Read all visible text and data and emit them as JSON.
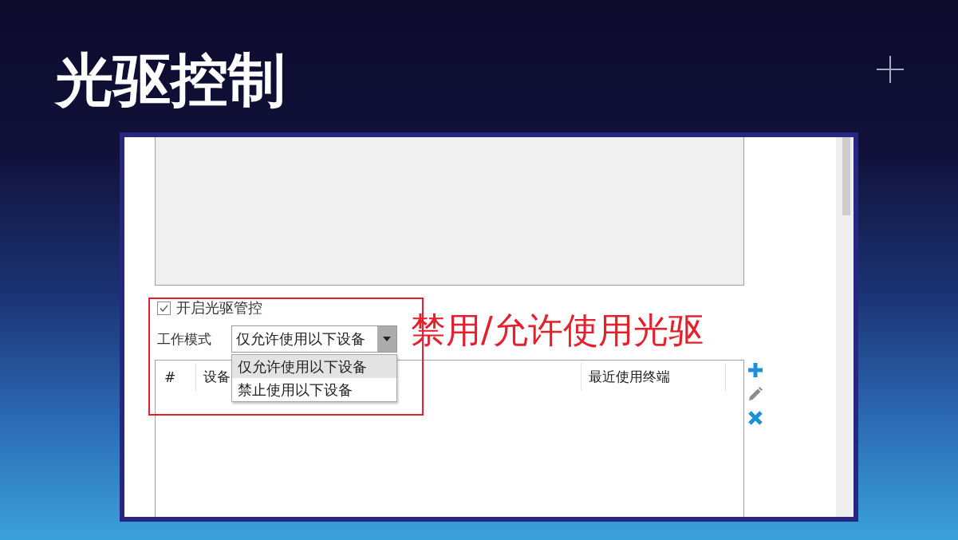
{
  "title": "光驱控制",
  "screenshot": {
    "enable_checkbox": {
      "label": "开启光驱管控",
      "checked": true
    },
    "work_mode": {
      "label": "工作模式",
      "value": "仅允许使用以下设备",
      "expanded": true,
      "options": [
        {
          "label": "仅允许使用以下设备",
          "selected": true
        },
        {
          "label": "禁止使用以下设备",
          "selected": false
        }
      ]
    },
    "table": {
      "columns": [
        "#",
        "设备",
        "最近使用终端"
      ]
    }
  },
  "annotation": {
    "label": "禁用/允许使用光驱"
  }
}
